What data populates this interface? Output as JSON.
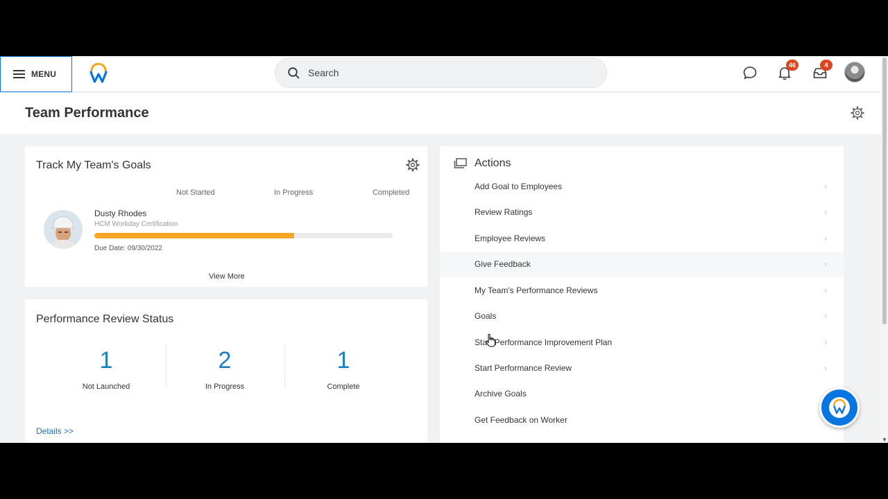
{
  "header": {
    "menu_label": "MENU",
    "search_placeholder": "Search",
    "notifications_count": "46",
    "inbox_count": "4"
  },
  "page": {
    "title": "Team Performance"
  },
  "goals_card": {
    "title": "Track My Team's Goals",
    "columns": [
      "Not Started",
      "In Progress",
      "Completed"
    ],
    "goal": {
      "name": "Dusty Rhodes",
      "plan": "HCM Workday Certification",
      "progress_percent": 67,
      "due_date": "Due Date: 09/30/2022"
    },
    "view_more": "View More"
  },
  "review_card": {
    "title": "Performance Review Status",
    "stats": [
      {
        "value": "1",
        "label": "Not Launched"
      },
      {
        "value": "2",
        "label": "In Progress"
      },
      {
        "value": "1",
        "label": "Complete"
      }
    ],
    "details_link": "Details >>"
  },
  "actions_card": {
    "title": "Actions",
    "items": [
      {
        "label": "Add Goal to Employees"
      },
      {
        "label": "Review Ratings"
      },
      {
        "label": "Employee Reviews"
      },
      {
        "label": "Give Feedback"
      },
      {
        "label": "My Team's Performance Reviews"
      },
      {
        "label": "Goals"
      },
      {
        "label": "Start Performance Improvement Plan"
      },
      {
        "label": "Start Performance Review"
      },
      {
        "label": "Archive Goals"
      },
      {
        "label": "Get Feedback on Worker"
      }
    ]
  },
  "colors": {
    "brand_blue": "#0875e1",
    "brand_orange": "#f5a623",
    "badge_red": "#de4620",
    "stat_blue": "#1a7fc1"
  },
  "icons": [
    "hamburger-icon",
    "workday-logo",
    "search-icon",
    "chat-icon",
    "bell-icon",
    "inbox-icon",
    "avatar",
    "gear-icon",
    "actions-icon",
    "chevron-right-icon",
    "assistant-icon"
  ]
}
